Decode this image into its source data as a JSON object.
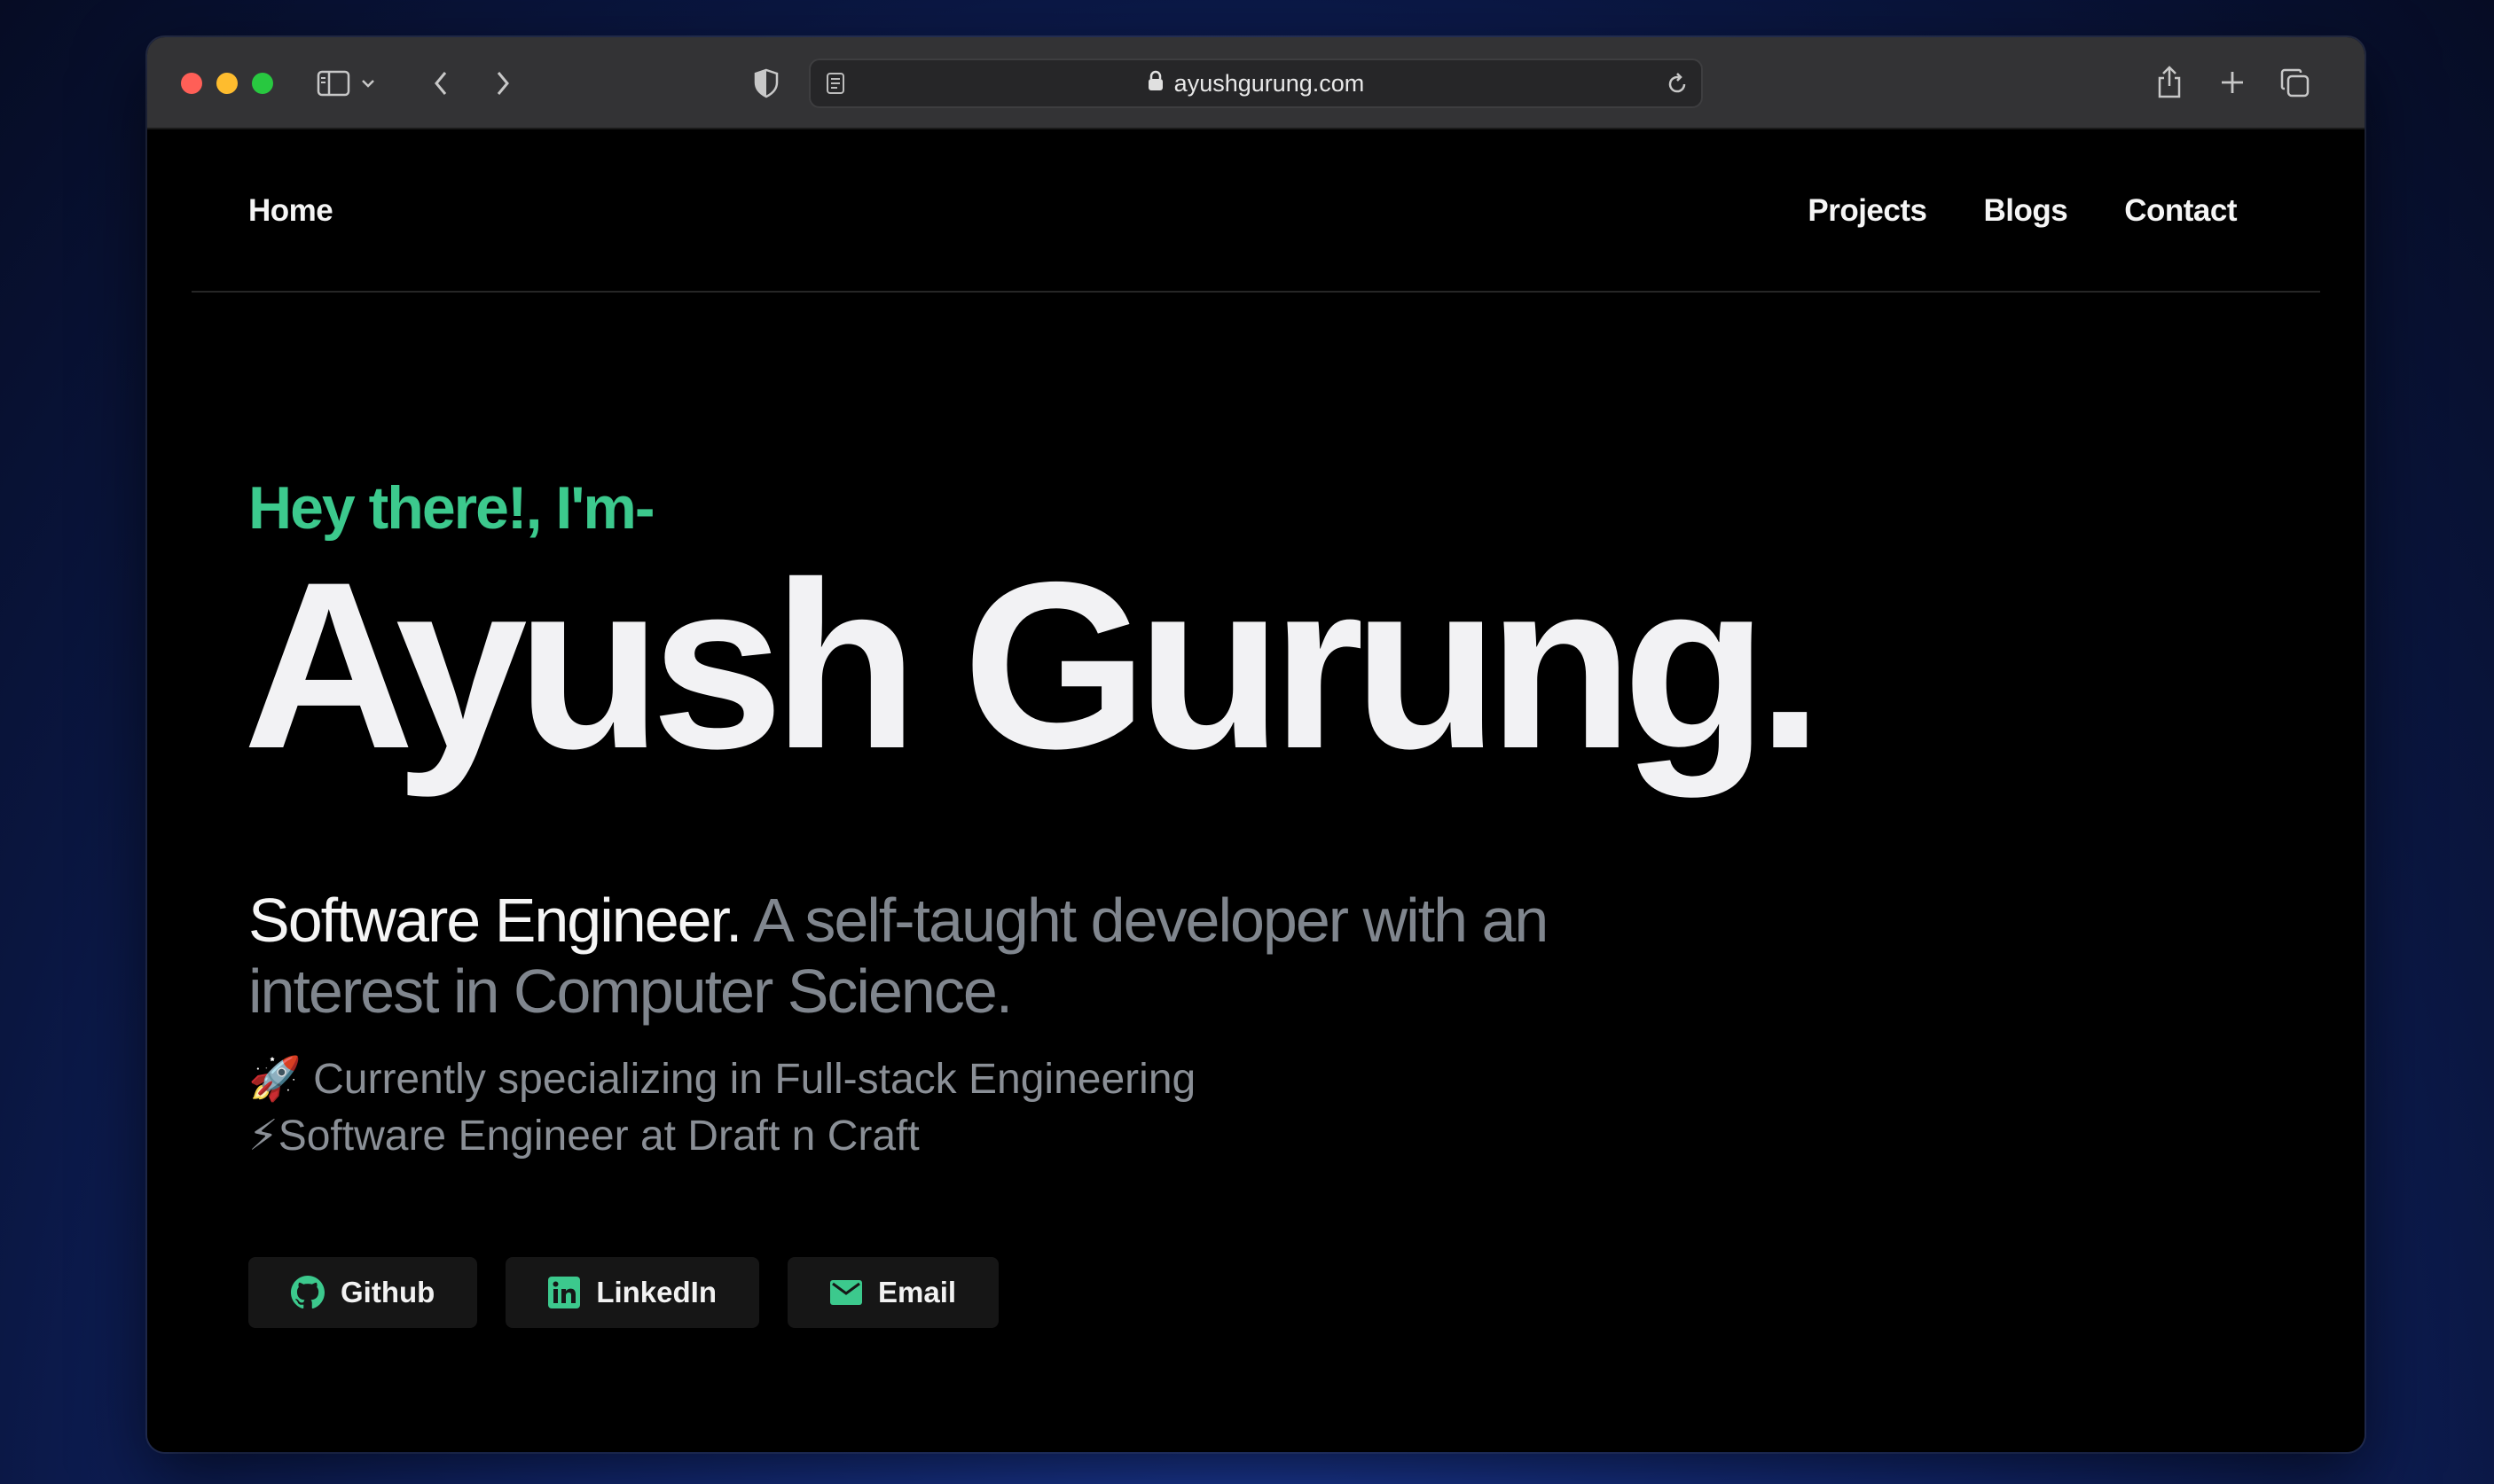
{
  "browser": {
    "url": "ayushgurung.com"
  },
  "nav": {
    "home": "Home",
    "links": [
      "Projects",
      "Blogs",
      "Contact"
    ]
  },
  "hero": {
    "greeting": "Hey there!, I'm-",
    "name": "Ayush Gurung.",
    "tagline_strong": "Software Engineer.",
    "tagline_muted": "A self-taught developer with an interest in Computer Science.",
    "spec_line1": "🚀 Currently specializing in Full-stack Engineering",
    "spec_line2": "⚡Software Engineer at Draft n Craft"
  },
  "buttons": {
    "github": "Github",
    "linkedin": "LinkedIn",
    "email": "Email"
  },
  "colors": {
    "accent": "#3cc98d",
    "page_bg": "#000000",
    "muted_text": "#80868e"
  }
}
